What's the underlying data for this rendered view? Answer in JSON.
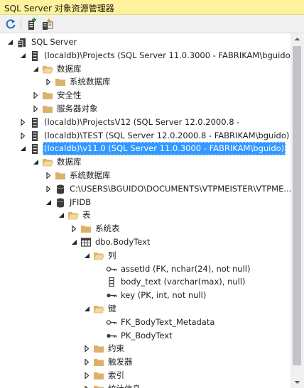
{
  "window": {
    "title": "SQL Server 对象资源管理器"
  },
  "toolbar": {
    "buttons": [
      {
        "icon": "refresh-icon"
      },
      {
        "icon": "add-server-icon"
      },
      {
        "icon": "new-query-icon"
      }
    ]
  },
  "colors": {
    "selection": "#3399ff",
    "titlebar": "#fff29d",
    "folder": "#dcb16a",
    "toggle": "#262626"
  },
  "tree": [
    {
      "label": "SQL Server",
      "depth": 0,
      "toggle": "expanded",
      "icon": "server-group-icon"
    },
    {
      "label": "(localdb)\\Projects (SQL Server 11.0.3000 - FABRIKAM\\bguido",
      "depth": 1,
      "toggle": "expanded",
      "icon": "server-icon"
    },
    {
      "label": "数据库",
      "depth": 2,
      "toggle": "expanded",
      "icon": "folder-open-icon"
    },
    {
      "label": "系统数据库",
      "depth": 3,
      "toggle": "collapsed",
      "icon": "folder-icon"
    },
    {
      "label": "安全性",
      "depth": 2,
      "toggle": "collapsed",
      "icon": "folder-icon"
    },
    {
      "label": "服务器对象",
      "depth": 2,
      "toggle": "collapsed",
      "icon": "folder-icon"
    },
    {
      "label": "(localdb)\\ProjectsV12 (SQL Server 12.0.2000.8 -",
      "depth": 1,
      "toggle": "collapsed",
      "icon": "server-icon"
    },
    {
      "label": "(localdb)\\TEST (SQL Server 12.0.2000.8 - FABRIKAM\\bguido)",
      "depth": 1,
      "toggle": "collapsed",
      "icon": "server-icon"
    },
    {
      "label": "(localdb)\\v11.0 (SQL Server 11.0.3000 - FABRIKAM\\bguido)",
      "depth": 1,
      "toggle": "expanded",
      "icon": "server-icon",
      "selected": true
    },
    {
      "label": "数据库",
      "depth": 2,
      "toggle": "expanded",
      "icon": "folder-open-icon"
    },
    {
      "label": "系统数据库",
      "depth": 3,
      "toggle": "collapsed",
      "icon": "folder-icon"
    },
    {
      "label": "C:\\USERS\\BGUIDO\\DOCUMENTS\\VTPMEISTER\\VTPME...",
      "depth": 3,
      "toggle": "collapsed",
      "icon": "database-icon"
    },
    {
      "label": "JFIDB",
      "depth": 3,
      "toggle": "expanded",
      "icon": "database-icon"
    },
    {
      "label": "表",
      "depth": 4,
      "toggle": "expanded",
      "icon": "folder-open-icon"
    },
    {
      "label": "系统表",
      "depth": 5,
      "toggle": "collapsed",
      "icon": "folder-icon"
    },
    {
      "label": "dbo.BodyText",
      "depth": 5,
      "toggle": "expanded",
      "icon": "table-icon"
    },
    {
      "label": "列",
      "depth": 6,
      "toggle": "expanded",
      "icon": "folder-open-icon"
    },
    {
      "label": "assetId (FK, nchar(24), not null)",
      "depth": 7,
      "toggle": "none",
      "icon": "foreign-key-column-icon"
    },
    {
      "label": "body_text (varchar(max), null)",
      "depth": 7,
      "toggle": "none",
      "icon": "column-icon"
    },
    {
      "label": "key (PK, int, not null)",
      "depth": 7,
      "toggle": "none",
      "icon": "primary-key-column-icon"
    },
    {
      "label": "键",
      "depth": 6,
      "toggle": "expanded",
      "icon": "folder-open-icon"
    },
    {
      "label": "FK_BodyText_Metadata",
      "depth": 7,
      "toggle": "none",
      "icon": "foreign-key-icon"
    },
    {
      "label": "PK_BodyText",
      "depth": 7,
      "toggle": "none",
      "icon": "primary-key-icon"
    },
    {
      "label": "约束",
      "depth": 6,
      "toggle": "collapsed",
      "icon": "folder-icon"
    },
    {
      "label": "触发器",
      "depth": 6,
      "toggle": "collapsed",
      "icon": "folder-icon"
    },
    {
      "label": "索引",
      "depth": 6,
      "toggle": "collapsed",
      "icon": "folder-icon"
    },
    {
      "label": "统计信息",
      "depth": 6,
      "toggle": "collapsed",
      "icon": "folder-icon"
    }
  ]
}
